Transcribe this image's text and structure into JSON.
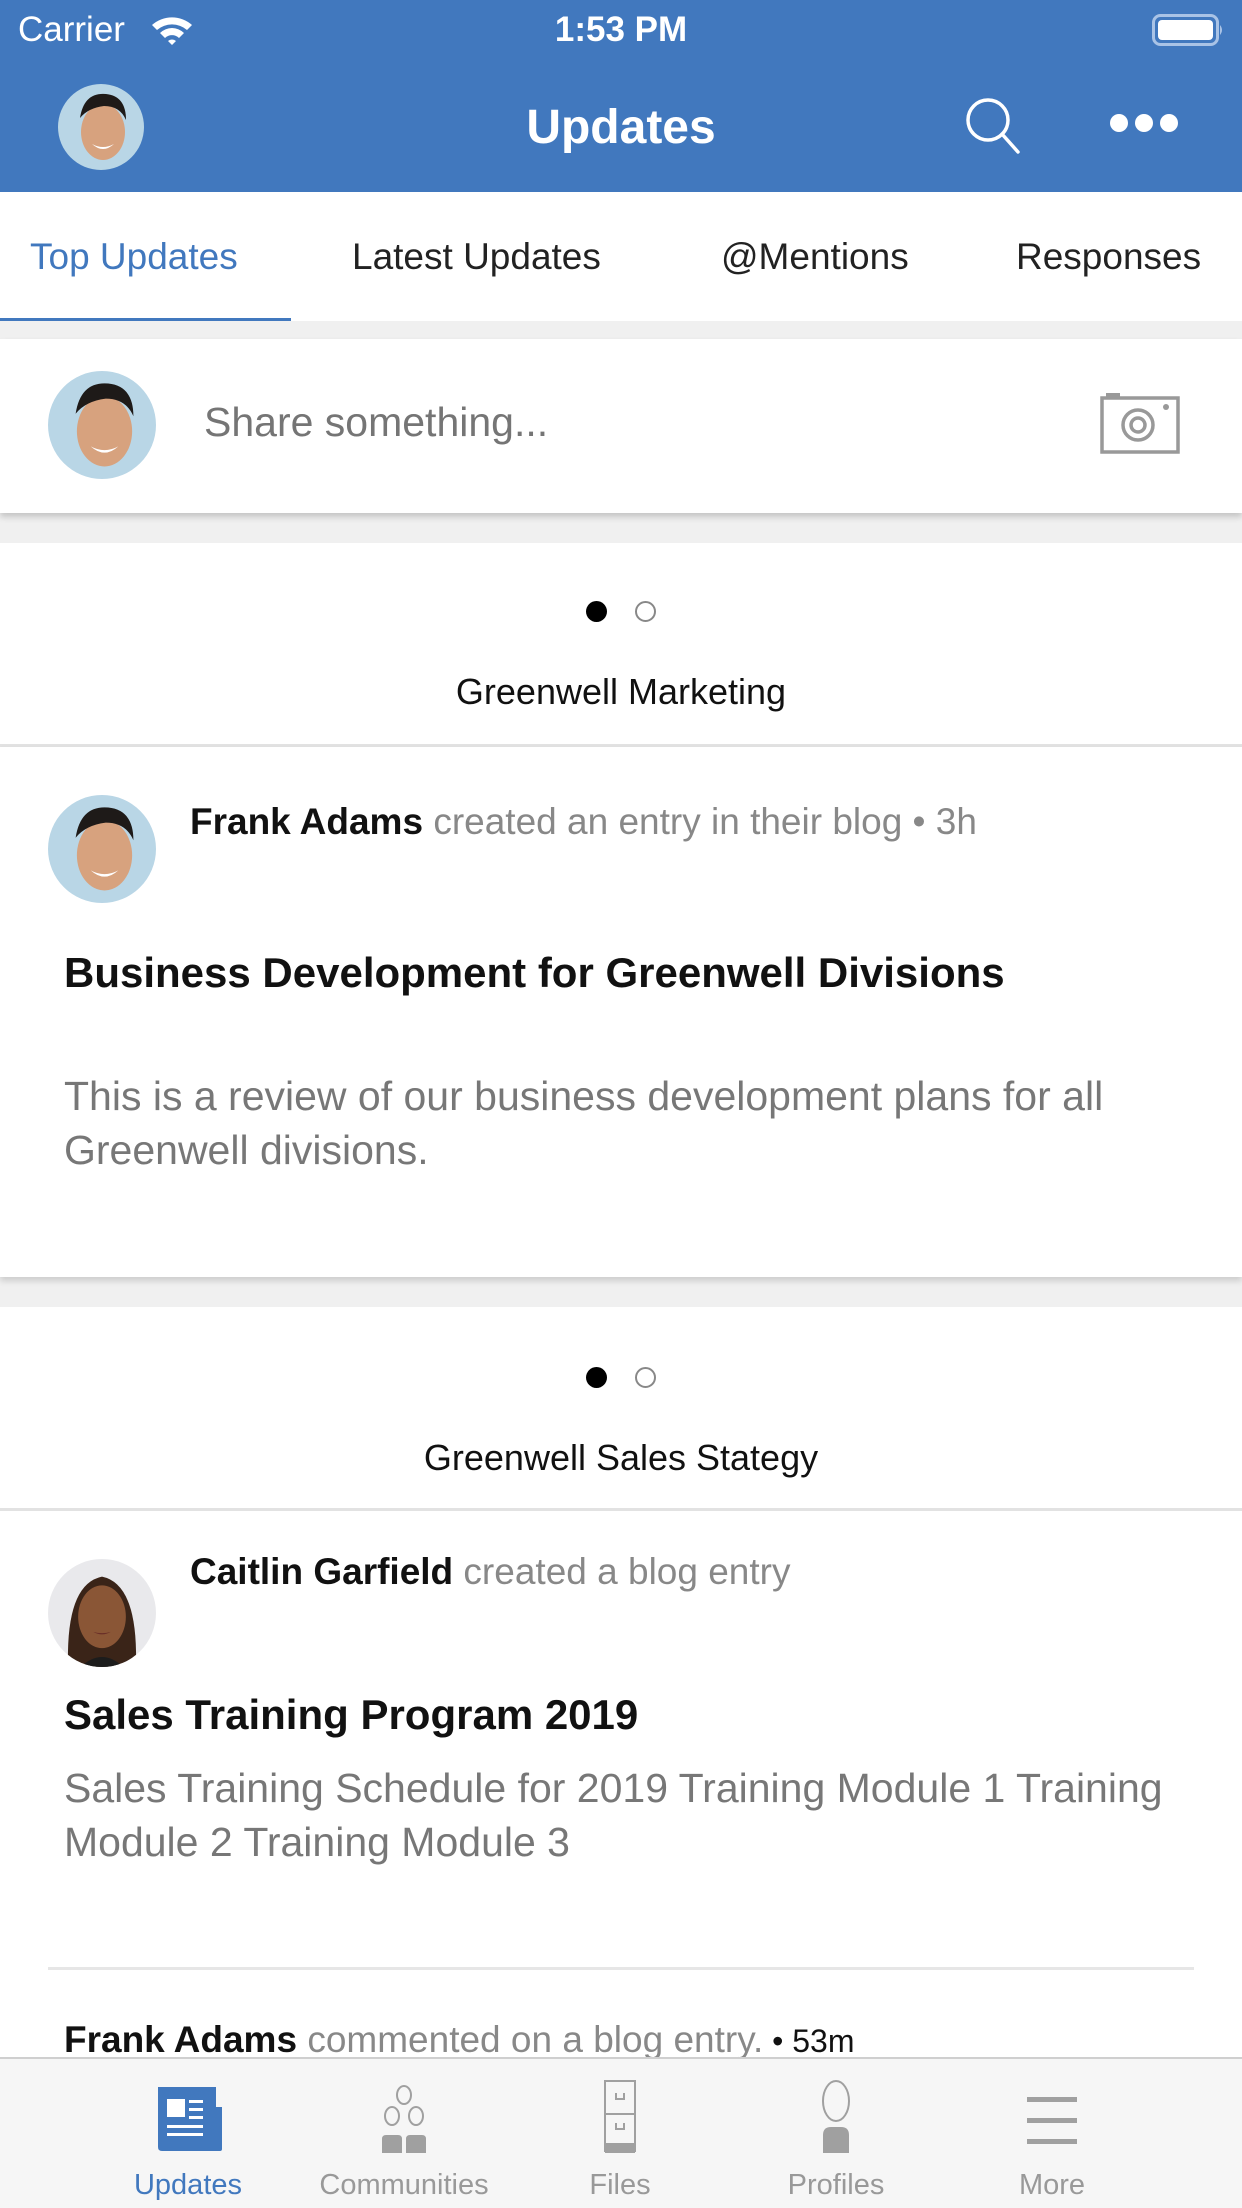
{
  "status_bar": {
    "carrier": "Carrier",
    "time": "1:53 PM"
  },
  "header": {
    "title": "Updates",
    "avatar_icon": "user-avatar-frank",
    "search_icon": "search-icon",
    "more_icon": "more-icon"
  },
  "colors": {
    "brand": "#4178be",
    "inactive": "#999999"
  },
  "tabs": [
    {
      "label": "Top Updates",
      "active": true
    },
    {
      "label": "Latest Updates",
      "active": false
    },
    {
      "label": "@Mentions",
      "active": false
    },
    {
      "label": "Responses",
      "active": false
    }
  ],
  "share": {
    "placeholder": "Share something...",
    "camera_icon": "camera-icon"
  },
  "cards": [
    {
      "title": "Greenwell Marketing",
      "pager": {
        "current": 1,
        "total": 2
      },
      "posts": [
        {
          "author": "Frank Adams",
          "action": " created an entry in their blog • 3h",
          "title": "Business Development for Greenwell Divisions",
          "body": "This is a review of our business development plans for all Greenwell divisions."
        }
      ]
    },
    {
      "title": "Greenwell Sales Stategy",
      "pager": {
        "current": 1,
        "total": 2
      },
      "posts": [
        {
          "author": "Caitlin Garfield",
          "action": " created a blog entry",
          "title": "Sales Training Program 2019",
          "body": "Sales Training Schedule for 2019   Training Module 1 Training Module 2  Training Module 3"
        },
        {
          "author": "Frank Adams",
          "action": " commented on a blog entry.",
          "time": " • 53m"
        }
      ]
    }
  ],
  "tabbar": [
    {
      "label": "Updates",
      "icon": "newspaper-icon",
      "active": true
    },
    {
      "label": "Communities",
      "icon": "communities-icon",
      "active": false
    },
    {
      "label": "Files",
      "icon": "file-cabinet-icon",
      "active": false
    },
    {
      "label": "Profiles",
      "icon": "person-icon",
      "active": false
    },
    {
      "label": "More",
      "icon": "menu-icon",
      "active": false
    }
  ]
}
